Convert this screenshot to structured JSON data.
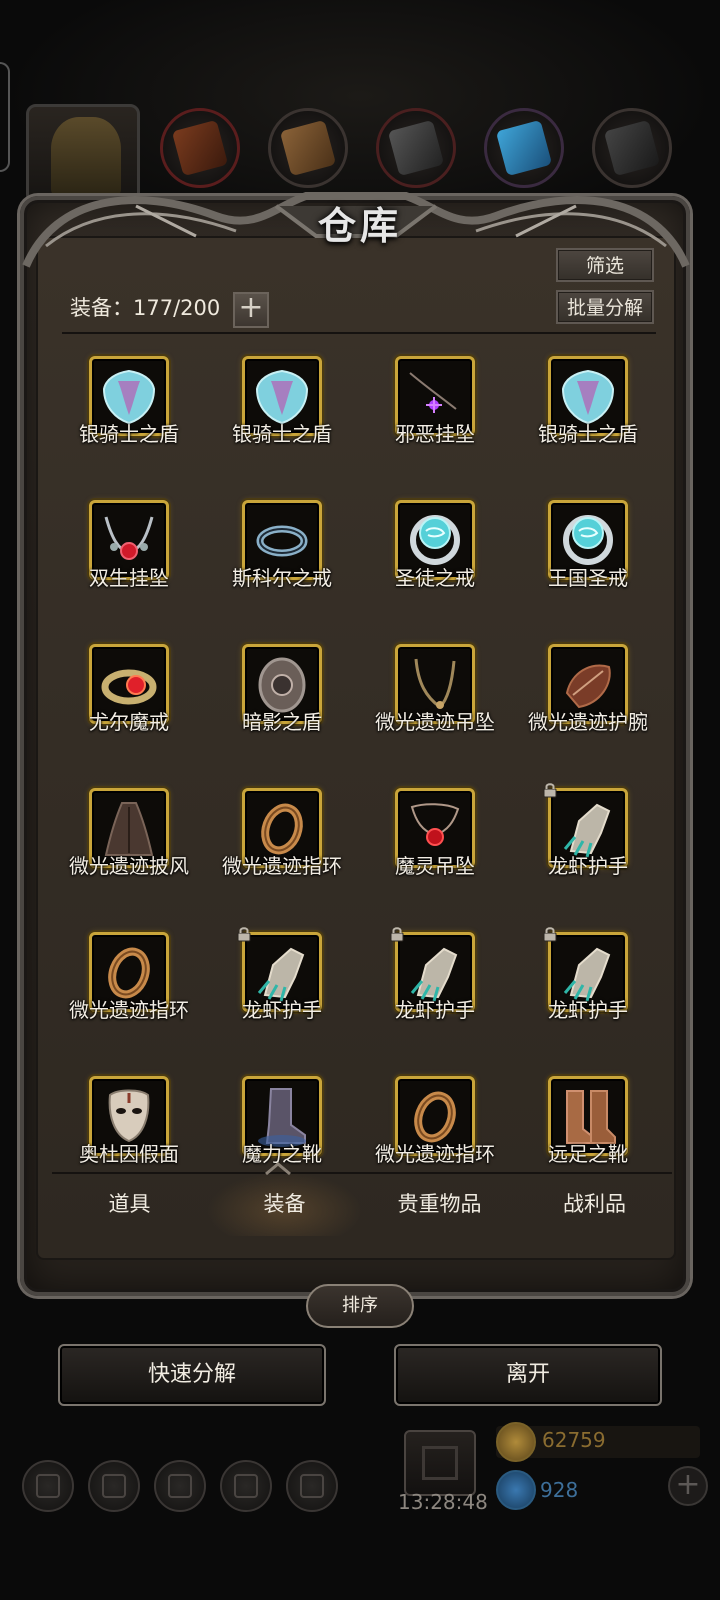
{
  "title": "仓库",
  "filter_label": "筛选",
  "batch_decompose_label": "批量分解",
  "capacity": {
    "label": "装备：177/200",
    "used": 177,
    "max": 200
  },
  "items": [
    {
      "name": "银骑士之盾",
      "icon": "silver-shield-icon",
      "locked": false
    },
    {
      "name": "银骑士之盾",
      "icon": "silver-shield-icon",
      "locked": false
    },
    {
      "name": "邪恶挂坠",
      "icon": "evil-pendant-icon",
      "locked": false
    },
    {
      "name": "银骑士之盾",
      "icon": "silver-shield-icon",
      "locked": false
    },
    {
      "name": "双生挂坠",
      "icon": "twin-pendant-icon",
      "locked": false
    },
    {
      "name": "斯科尔之戒",
      "icon": "ring-icon",
      "locked": false
    },
    {
      "name": "圣徒之戒",
      "icon": "saint-ring-icon",
      "locked": false
    },
    {
      "name": "王国圣戒",
      "icon": "saint-ring-icon",
      "locked": false
    },
    {
      "name": "尤尔魔戒",
      "icon": "ruby-ring-icon",
      "locked": false
    },
    {
      "name": "暗影之盾",
      "icon": "shadow-shield-icon",
      "locked": false
    },
    {
      "name": "微光遗迹吊坠",
      "icon": "necklace-icon",
      "locked": false
    },
    {
      "name": "微光遗迹护腕",
      "icon": "bracer-icon",
      "locked": false
    },
    {
      "name": "微光遗迹披风",
      "icon": "cloak-icon",
      "locked": false
    },
    {
      "name": "微光遗迹指环",
      "icon": "bronze-ring-icon",
      "locked": false
    },
    {
      "name": "魔灵吊坠",
      "icon": "demon-pendant-icon",
      "locked": false
    },
    {
      "name": "龙虾护手",
      "icon": "gauntlet-icon",
      "locked": true
    },
    {
      "name": "微光遗迹指环",
      "icon": "bronze-ring-icon",
      "locked": false
    },
    {
      "name": "龙虾护手",
      "icon": "gauntlet-icon",
      "locked": true
    },
    {
      "name": "龙虾护手",
      "icon": "gauntlet-icon",
      "locked": true
    },
    {
      "name": "龙虾护手",
      "icon": "gauntlet-icon",
      "locked": true
    },
    {
      "name": "奥杜因假面",
      "icon": "mask-icon",
      "locked": false
    },
    {
      "name": "魔力之靴",
      "icon": "blue-boots-icon",
      "locked": false
    },
    {
      "name": "微光遗迹指环",
      "icon": "bronze-ring-icon",
      "locked": false
    },
    {
      "name": "远足之靴",
      "icon": "boots-icon",
      "locked": false
    }
  ],
  "tabs": [
    {
      "label": "道具",
      "active": false
    },
    {
      "label": "装备",
      "active": true
    },
    {
      "label": "贵重物品",
      "active": false
    },
    {
      "label": "战利品",
      "active": false
    }
  ],
  "sort_label": "排序",
  "quick_decompose_label": "快速分解",
  "leave_label": "离开",
  "hud": {
    "time": "13:28:48",
    "gold": "62759",
    "gems": "928"
  },
  "colors": {
    "frame_gold": "#c9a53a",
    "panel": "#2e2821",
    "text": "#f2ede4"
  }
}
